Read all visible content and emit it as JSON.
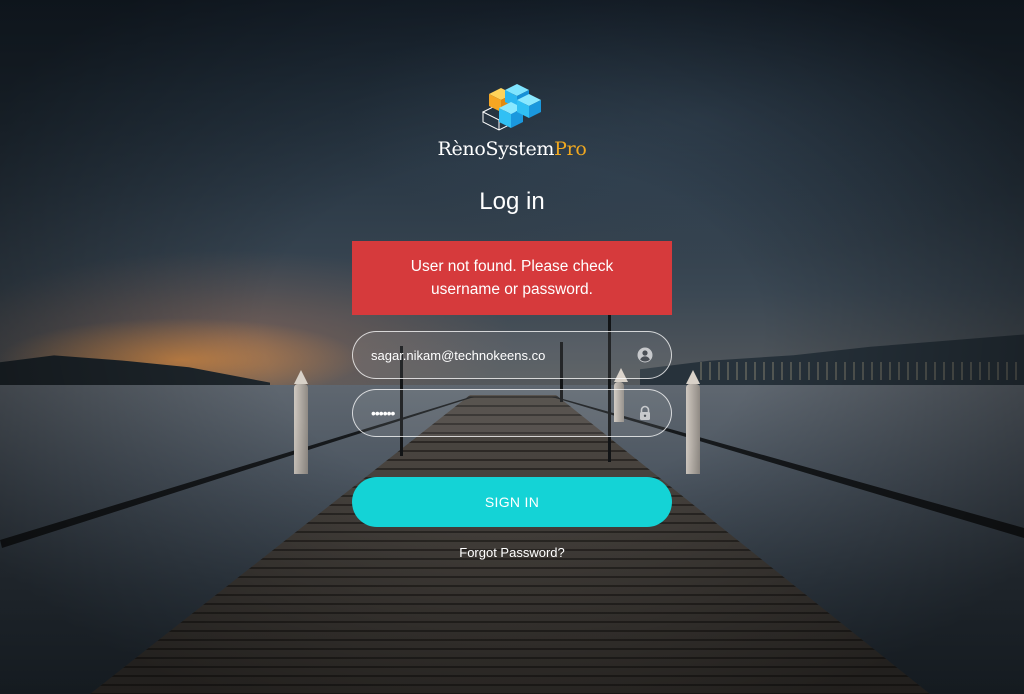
{
  "brand": {
    "name_main": "RènoSystem",
    "name_accent": "Pro",
    "logo_icon": "stacked-cubes-logo",
    "accent_color": "#f0a820"
  },
  "login": {
    "title": "Log in",
    "error_message": "User not found. Please check username or password.",
    "error_color": "#d63a3c",
    "username_value": "sagar.nikam@technokeens.co",
    "username_icon": "user-circle-icon",
    "password_value": "••••••",
    "password_icon": "lock-icon",
    "submit_label": "SIGN IN",
    "submit_color": "#14d3d6",
    "forgot_label": "Forgot Password?"
  }
}
